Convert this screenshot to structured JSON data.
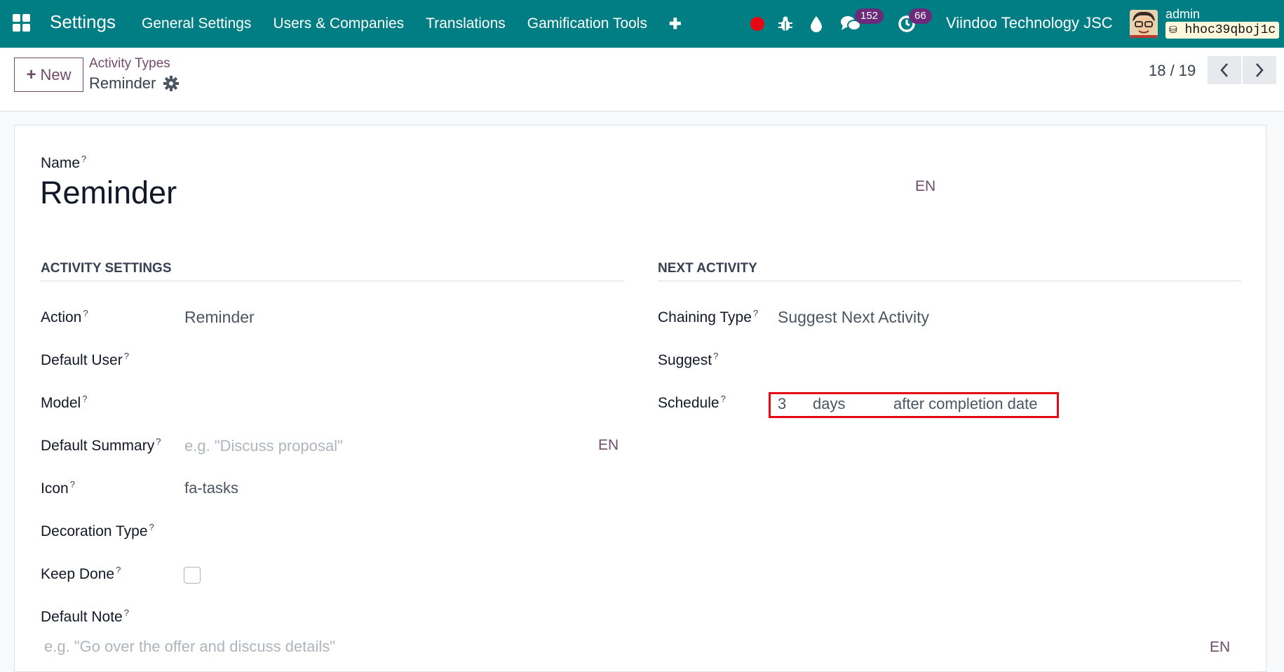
{
  "navbar": {
    "app_title": "Settings",
    "menu": [
      "General Settings",
      "Users & Companies",
      "Translations",
      "Gamification Tools"
    ],
    "add_symbol": "✚",
    "messages_count": "152",
    "activities_count": "66",
    "company": "Viindoo Technology JSC",
    "user": "admin",
    "database": "hhoc39qboj1c",
    "accent_color": "#017e84"
  },
  "control_panel": {
    "new_label": "New",
    "breadcrumb_parent": "Activity Types",
    "breadcrumb_current": "Reminder",
    "pager": "18 / 19"
  },
  "form": {
    "name_label": "Name",
    "name_value": "Reminder",
    "lang": "EN",
    "help_mark": "?",
    "activity_settings": {
      "title": "ACTIVITY SETTINGS",
      "action_label": "Action",
      "action_value": "Reminder",
      "default_user_label": "Default User",
      "model_label": "Model",
      "default_summary_label": "Default Summary",
      "default_summary_placeholder": "e.g. \"Discuss proposal\"",
      "icon_label": "Icon",
      "icon_value": "fa-tasks",
      "decoration_type_label": "Decoration Type",
      "keep_done_label": "Keep Done",
      "keep_done_checked": false,
      "default_note_label": "Default Note",
      "default_note_placeholder": "e.g. \"Go over the offer and discuss details\""
    },
    "next_activity": {
      "title": "NEXT ACTIVITY",
      "chaining_type_label": "Chaining Type",
      "chaining_type_value": "Suggest Next Activity",
      "suggest_label": "Suggest",
      "schedule_label": "Schedule",
      "schedule_delay": "3",
      "schedule_unit": "days",
      "schedule_from": "after completion date"
    }
  }
}
